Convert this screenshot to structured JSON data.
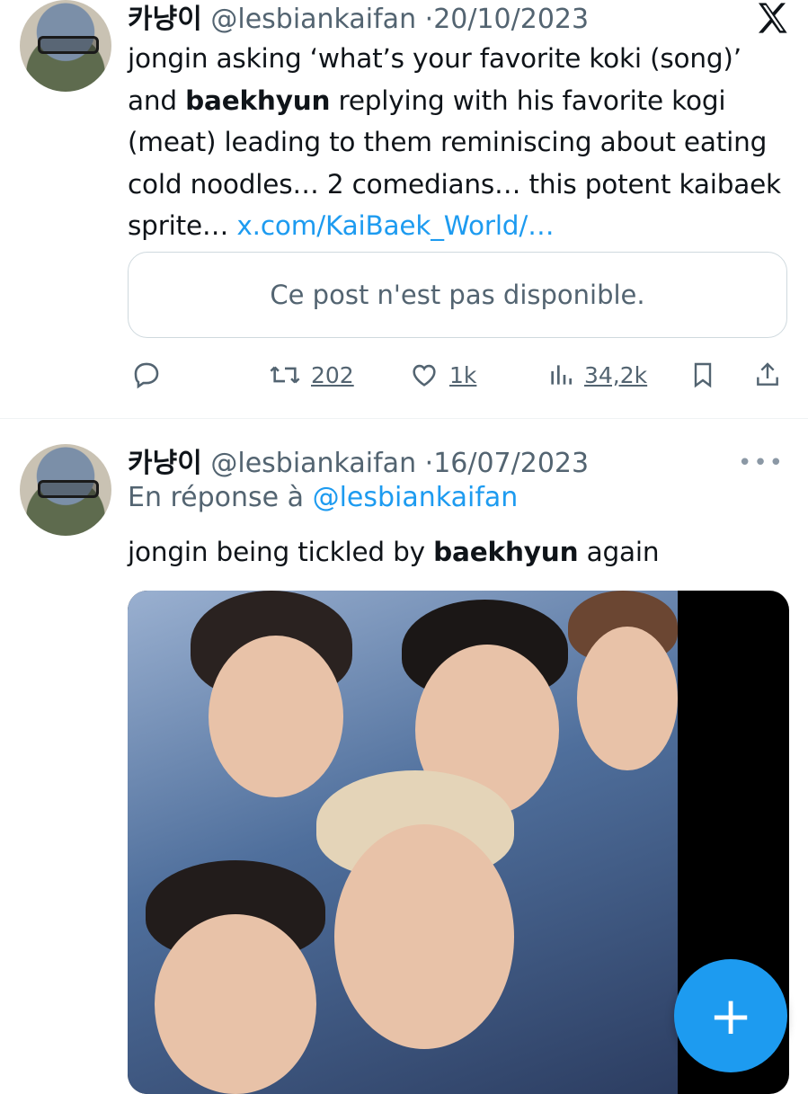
{
  "tweet1": {
    "display_name": "카냥이",
    "handle": "@lesbiankaifan",
    "separator": "·",
    "date": "20/10/2023",
    "text_part1": "jongin asking ‘what’s your favorite koki (song)’ and ",
    "text_bold": "baekhyun",
    "text_part2": " replying with his favorite kogi (meat) leading to them reminiscing about eating cold noodles… 2 comedians… this potent kaibaek sprite… ",
    "link_text": "x.com/KaiBaek_World/…",
    "unavailable_text": "Ce post n'est pas disponible.",
    "actions": {
      "reply_icon": "reply-icon",
      "retweet_icon": "retweet-icon",
      "retweets": "202",
      "like_icon": "like-icon",
      "likes": "1k",
      "views_icon": "views-icon",
      "views": "34,2k",
      "bookmark_icon": "bookmark-icon",
      "share_icon": "share-icon"
    }
  },
  "tweet2": {
    "display_name": "카냥이",
    "handle": "@lesbiankaifan",
    "separator": "·",
    "date": "16/07/2023",
    "reply_prefix": "En réponse à ",
    "reply_to": "@lesbiankaifan",
    "text_part1": "jongin being tickled by ",
    "text_bold": "baekhyun",
    "text_part2": " again",
    "more_icon": "more-icon",
    "media_icon": "video-thumbnail"
  },
  "fab": {
    "icon": "plus-icon",
    "label": "+"
  },
  "brand_icon": "x-logo-icon",
  "colors": {
    "accent": "#1d9bf0",
    "text": "#0f1419",
    "muted": "#536471",
    "border": "#cfd9de"
  }
}
